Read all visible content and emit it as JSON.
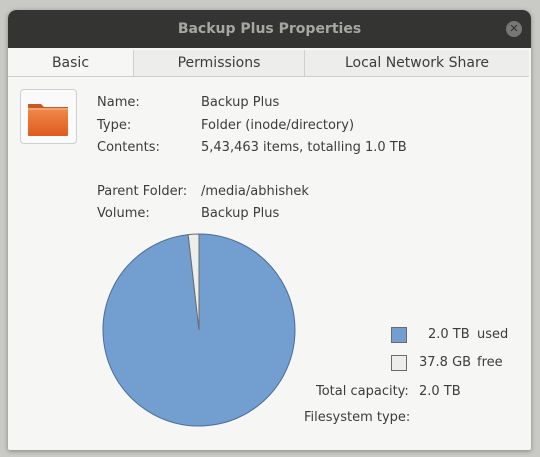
{
  "window": {
    "title": "Backup Plus Properties"
  },
  "tabs": [
    {
      "label": "Basic",
      "active": true
    },
    {
      "label": "Permissions",
      "active": false
    },
    {
      "label": "Local Network Share",
      "active": false
    }
  ],
  "info": {
    "name_label": "Name:",
    "name_value": "Backup Plus",
    "type_label": "Type:",
    "type_value": "Folder (inode/directory)",
    "contents_label": "Contents:",
    "contents_value": "5,43,463 items, totalling 1.0 TB",
    "parent_label": "Parent Folder:",
    "parent_value": "/media/abhishek",
    "volume_label": "Volume:",
    "volume_value": "Backup Plus"
  },
  "usage": {
    "used_value": "2.0 TB",
    "used_label": "used",
    "free_value": "37.8 GB",
    "free_label": "free",
    "capacity_label": "Total capacity:",
    "capacity_value": "2.0 TB",
    "fs_label": "Filesystem type:",
    "fs_value": "",
    "used_fraction": 0.982,
    "used_color": "#729fcf",
    "free_color": "#ededeb"
  }
}
